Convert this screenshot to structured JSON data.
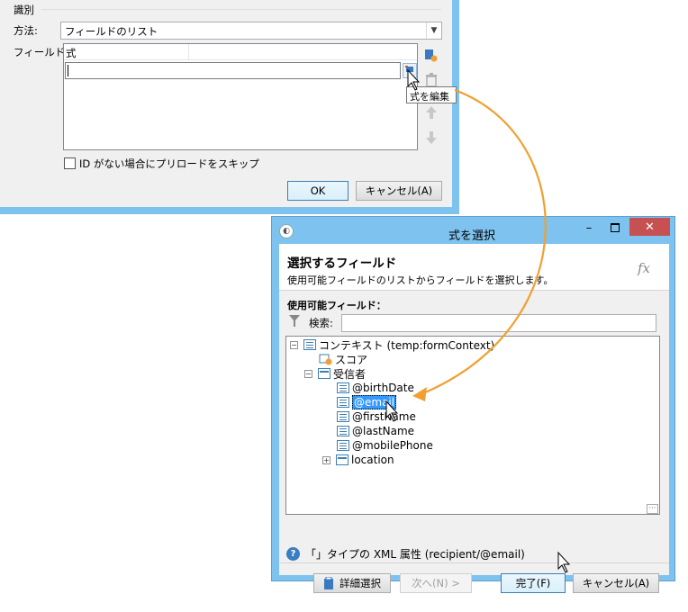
{
  "dialog1": {
    "group_label": "識別",
    "method_label": "方法:",
    "method_value": "フィールドのリスト",
    "field_label": "フィールド:",
    "list_header": "式",
    "tooltip": "式を編集",
    "checkbox_label": "ID がない場合にプリロードをスキップ",
    "ok_label": "OK",
    "cancel_label": "キャンセル(A)"
  },
  "dialog2": {
    "title": "式を選択",
    "heading": "選択するフィールド",
    "subheading": "使用可能フィールドのリストからフィールドを選択します。",
    "fx": "fx",
    "available_label": "使用可能フィールド：",
    "search_label": "検索:",
    "search_value": "",
    "tree": [
      {
        "label": "コンテキスト (temp:formContext)",
        "toggle": "−"
      },
      {
        "label": "スコア",
        "toggle": ""
      },
      {
        "label": "受信者",
        "toggle": "−"
      },
      {
        "label": "@birthDate",
        "toggle": ""
      },
      {
        "label": "@email",
        "toggle": ""
      },
      {
        "label": "@firstName",
        "toggle": ""
      },
      {
        "label": "@lastName",
        "toggle": ""
      },
      {
        "label": "@mobilePhone",
        "toggle": ""
      },
      {
        "label": "location",
        "toggle": "+"
      }
    ],
    "more": "···",
    "status": "「」タイプの XML 属性 (recipient/@email)",
    "buttons": {
      "advanced": "詳細選択",
      "next": "次へ(N) >",
      "finish": "完了(F)",
      "cancel": "キャンセル(A)"
    }
  },
  "colors": {
    "accent": "#f0a030",
    "title_bar": "#7ec2ef",
    "selection": "#3399ff",
    "close": "#c75050"
  }
}
